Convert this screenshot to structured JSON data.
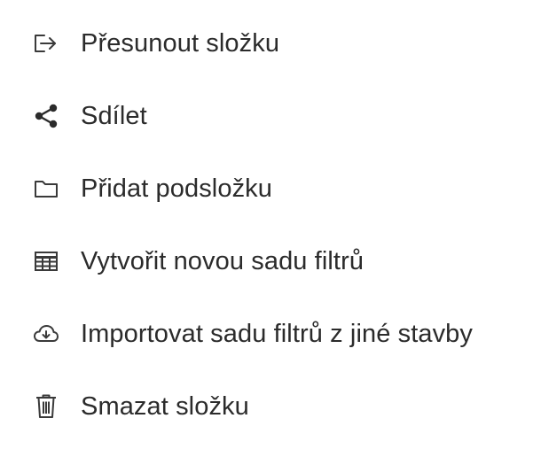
{
  "menu": {
    "items": [
      {
        "icon": "move-folder-icon",
        "label": "Přesunout složku"
      },
      {
        "icon": "share-icon",
        "label": "Sdílet"
      },
      {
        "icon": "folder-icon",
        "label": "Přidat podsložku"
      },
      {
        "icon": "table-icon",
        "label": "Vytvořit novou sadu filtrů"
      },
      {
        "icon": "cloud-download-icon",
        "label": "Importovat sadu filtrů z jiné stavby"
      },
      {
        "icon": "trash-icon",
        "label": "Smazat složku"
      }
    ]
  }
}
